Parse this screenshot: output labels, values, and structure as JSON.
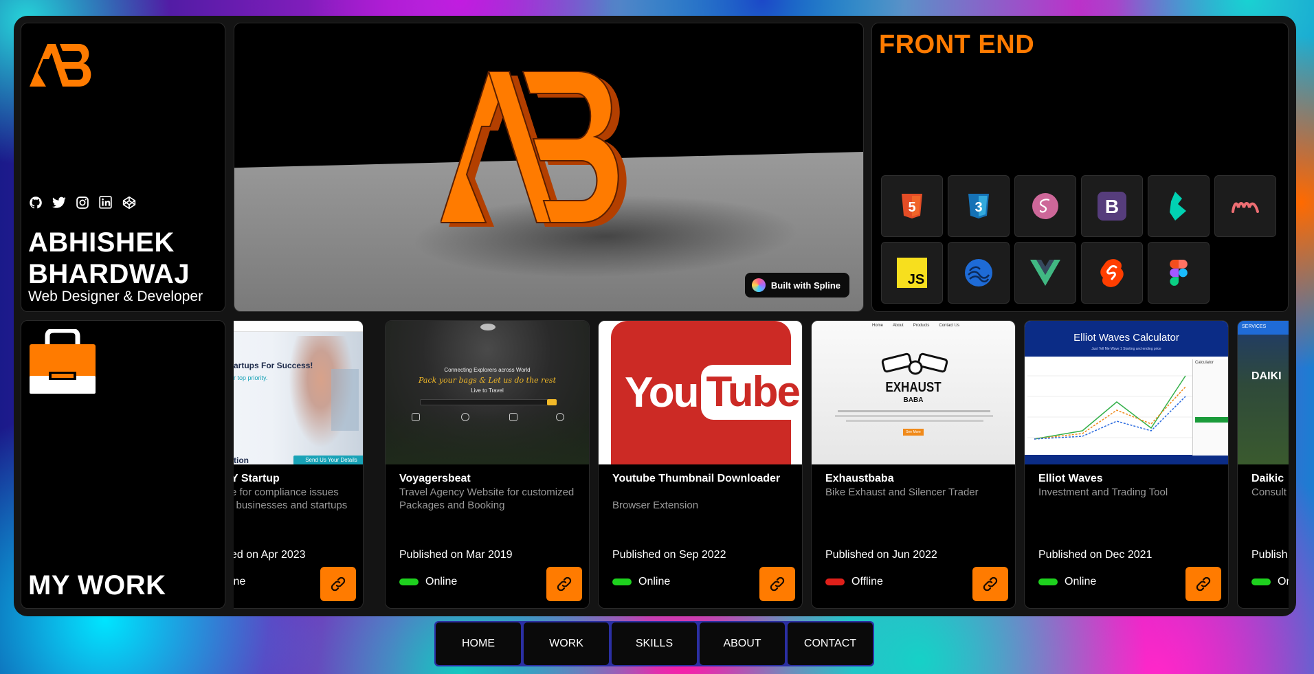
{
  "profile": {
    "name_line1": "ABHISHEK",
    "name_line2": "BHARDWAJ",
    "role": "Web Designer & Developer",
    "socials": [
      "github-icon",
      "twitter-icon",
      "instagram-icon",
      "linkedin-icon",
      "codepen-icon"
    ],
    "accent": "#ff7b00"
  },
  "hero": {
    "badge": "Built with Spline"
  },
  "skills": {
    "title": "FRONT END",
    "icons": [
      "html5-icon",
      "css3-icon",
      "sass-icon",
      "bootstrap-icon",
      "bulma-icon",
      "materialize-icon",
      "javascript-icon",
      "gsap-icon",
      "vue-icon",
      "svelte-icon",
      "figma-icon"
    ],
    "html_label": "5",
    "css_label": "3",
    "bootstrap_label": "B",
    "js_label": "JS"
  },
  "work": {
    "title": "MY WORK",
    "projects": [
      {
        "title": "Y Startup",
        "desc": "e for compliance issues\nl businesses and startups",
        "published": "ed on Apr 2023",
        "status": "ine",
        "status_color": "#1ed11e",
        "thumb_headline": "artups For Success!",
        "thumb_sub": "r top priority.",
        "thumb_word": "tion",
        "thumb_button": "Send Us Your Details"
      },
      {
        "title": "Voyagersbeat",
        "desc": "Travel Agency Website for customized Packages and Booking",
        "published": "Published on Mar 2019",
        "status": "Online",
        "status_color": "#1ed11e",
        "thumb_line1": "Connecting Explorers across World",
        "thumb_line2": "Pack your bags & Let us do the rest",
        "thumb_line3": "Live to Travel"
      },
      {
        "title": "Youtube Thumbnail Downloader",
        "desc": "Browser Extension",
        "published": "Published on Sep 2022",
        "status": "Online",
        "status_color": "#1ed11e",
        "thumb_you": "You",
        "thumb_tube": "Tube"
      },
      {
        "title": "Exhaustbaba",
        "desc": "Bike Exhaust and Silencer Trader",
        "published": "Published on Jun 2022",
        "status": "Offline",
        "status_color": "#e0201a",
        "thumb_nav": [
          "Home",
          "About",
          "Products",
          "Contact Us"
        ],
        "thumb_brand1": "EXHAUST",
        "thumb_brand2": "BABA",
        "thumb_cta": "See More"
      },
      {
        "title": "Elliot Waves",
        "desc": "Investment and Trading Tool",
        "published": "Published on Dec 2021",
        "status": "Online",
        "status_color": "#1ed11e",
        "thumb_title": "Elliot Waves Calculator",
        "thumb_sub": "Just Tell Me Wave 1 Starting and ending price",
        "thumb_panel": "Calculator"
      },
      {
        "title": "Daikic",
        "desc": "Consult",
        "published": "Publish",
        "status": "On",
        "status_color": "#1ed11e",
        "thumb_tag": "SERVICES",
        "thumb_word": "DAIKI"
      }
    ]
  },
  "nav": {
    "items": [
      "HOME",
      "WORK",
      "SKILLS",
      "ABOUT",
      "CONTACT"
    ]
  }
}
